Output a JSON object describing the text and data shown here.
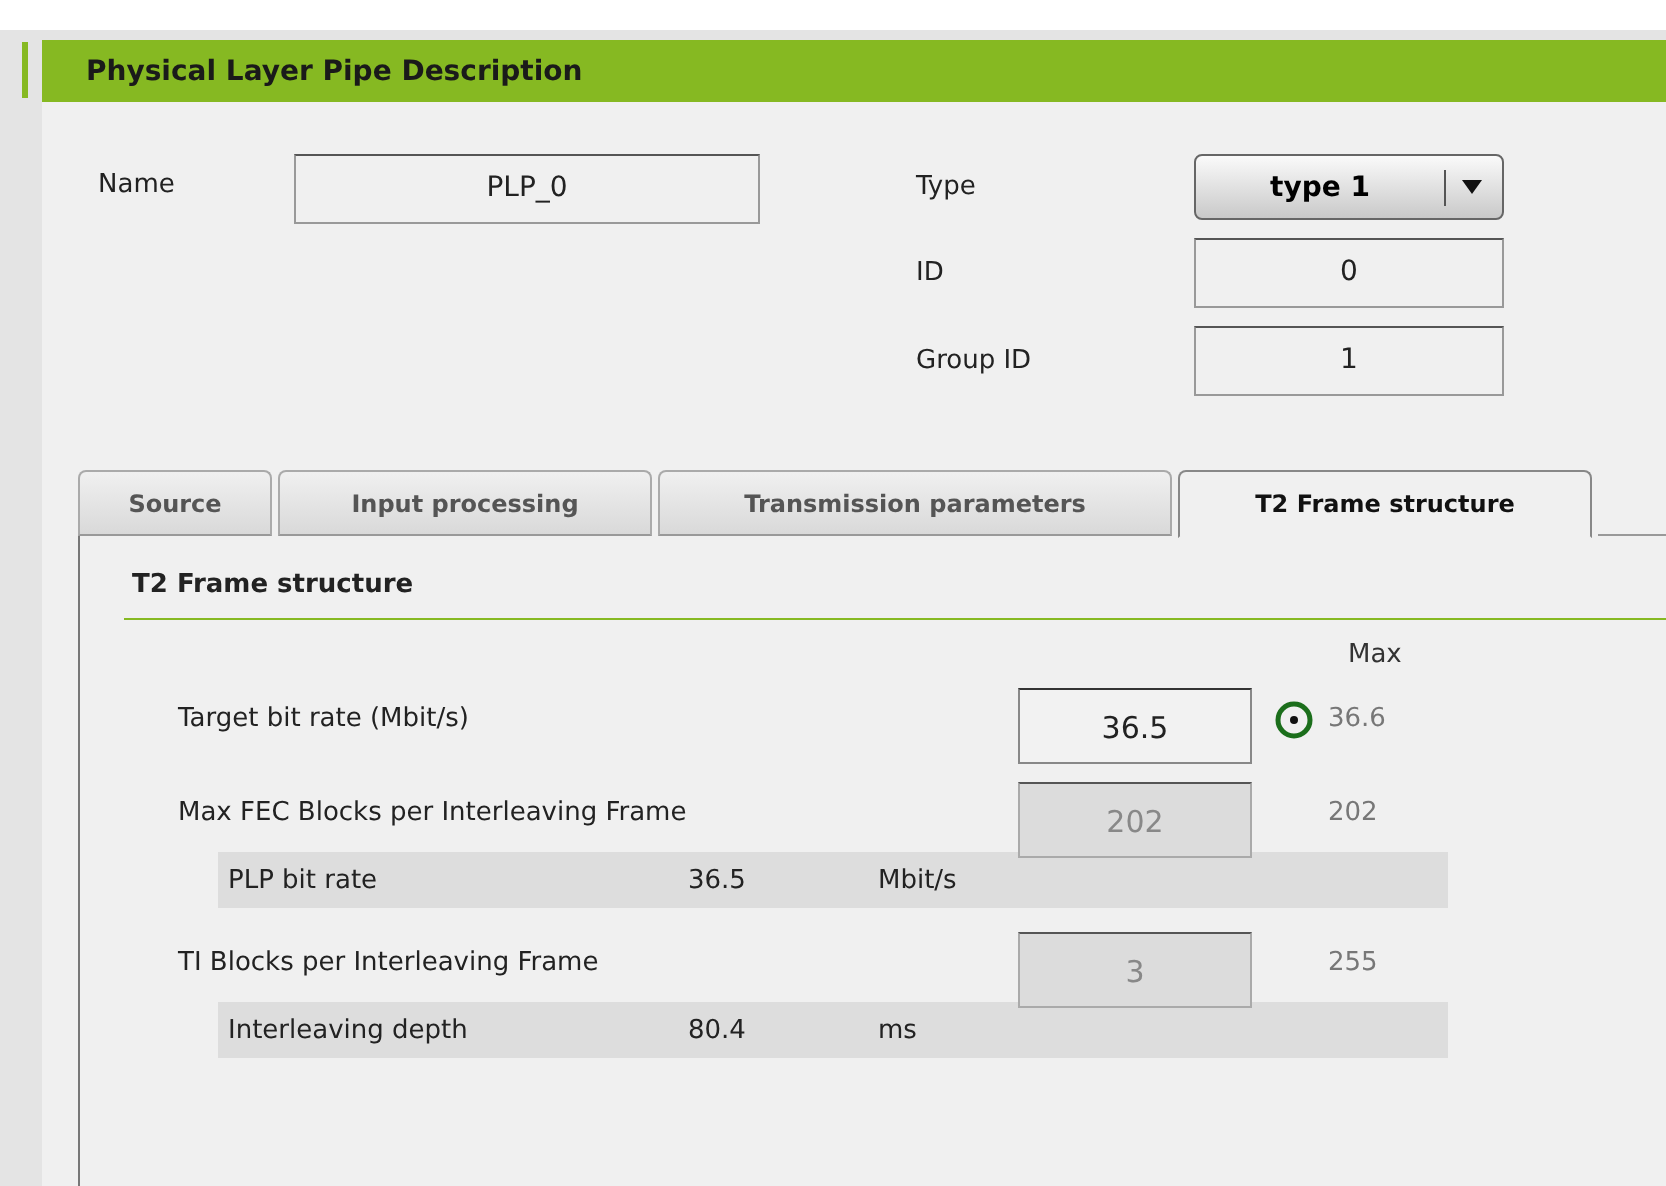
{
  "panel": {
    "title": "Physical Layer Pipe Description"
  },
  "name_field": {
    "label": "Name",
    "value": "PLP_0"
  },
  "right_fields": [
    {
      "kind": "dropdown",
      "label": "Type",
      "value": "type 1"
    },
    {
      "kind": "input",
      "label": "ID",
      "value": "0"
    },
    {
      "kind": "input",
      "label": "Group ID",
      "value": "1"
    }
  ],
  "tabs": [
    {
      "label": "Source",
      "selected": false
    },
    {
      "label": "Input processing",
      "selected": false
    },
    {
      "label": "Transmission parameters",
      "selected": false
    },
    {
      "label": "T2 Frame structure",
      "selected": true
    }
  ],
  "section": {
    "title": "T2 Frame structure",
    "max_header": "Max",
    "rows": [
      {
        "kind": "input",
        "label": "Target bit rate (Mbit/s)",
        "value": "36.5",
        "disabled": false,
        "indicator": true,
        "max": "36.6"
      },
      {
        "kind": "input",
        "label": "Max FEC Blocks per Interleaving Frame",
        "value": "202",
        "disabled": true,
        "indicator": false,
        "max": "202"
      },
      {
        "kind": "info",
        "label": "PLP bit rate",
        "value": "36.5",
        "unit": "Mbit/s"
      },
      {
        "kind": "input",
        "label": "TI Blocks per Interleaving Frame",
        "value": "3",
        "disabled": true,
        "indicator": false,
        "max": "255"
      },
      {
        "kind": "info",
        "label": "Interleaving depth",
        "value": "80.4",
        "unit": "ms"
      }
    ]
  }
}
